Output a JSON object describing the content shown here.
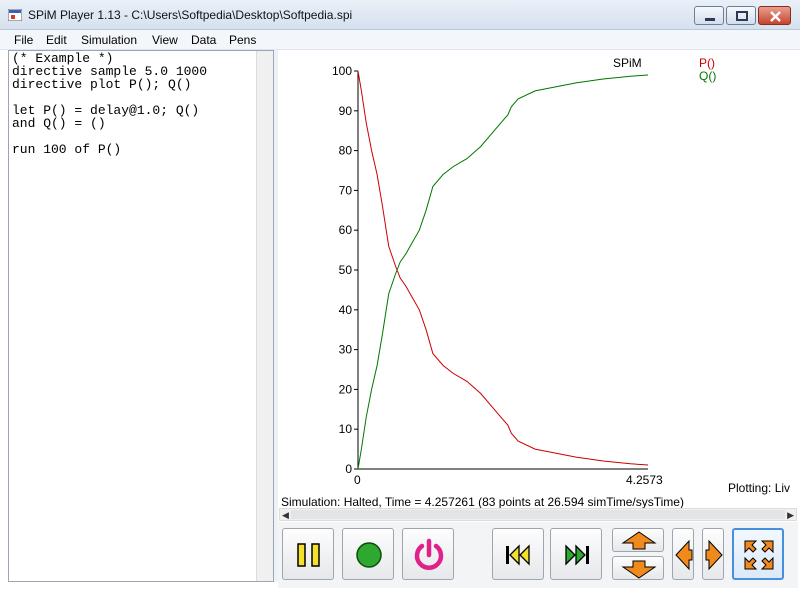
{
  "window": {
    "title": "SPiM Player 1.13 - C:\\Users\\Softpedia\\Desktop\\Softpedia.spi"
  },
  "menu": [
    "File",
    "Edit",
    "Simulation",
    "View",
    "Data",
    "Pens"
  ],
  "editor": {
    "lines": [
      "(* Example *)",
      "directive sample 5.0 1000",
      "directive plot P(); Q()",
      "",
      "let P() = delay@1.0; Q()",
      "and Q() = ()",
      "",
      "run 100 of P()"
    ]
  },
  "status": {
    "simulation": "Simulation: Halted, Time = 4.257261 (83 points at 26.594 simTime/sysTime)",
    "plotting": "Plotting: Liv"
  },
  "colors": {
    "P": "#cc0000",
    "Q": "#007700",
    "accent": "#4a8ee0"
  },
  "toolbar": {
    "buttons": [
      {
        "name": "pause",
        "icon": "pause-icon"
      },
      {
        "name": "record",
        "icon": "record-icon"
      },
      {
        "name": "power",
        "icon": "power-icon"
      },
      {
        "name": "rewind",
        "icon": "fast-rewind-icon"
      },
      {
        "name": "forward",
        "icon": "fast-forward-icon"
      },
      {
        "name": "zoom-up",
        "icon": "arrow-up-icon"
      },
      {
        "name": "zoom-down",
        "icon": "arrow-down-icon"
      },
      {
        "name": "scroll-left",
        "icon": "arrow-left-icon"
      },
      {
        "name": "scroll-right",
        "icon": "arrow-right-icon"
      },
      {
        "name": "fit",
        "icon": "expand-icon"
      }
    ]
  },
  "chart_data": {
    "type": "line",
    "title": "SPiM",
    "xlim": [
      0,
      4.2573
    ],
    "ylim": [
      0,
      100
    ],
    "x_ticks": [
      "0",
      "4.2573"
    ],
    "y_ticks": [
      0,
      10,
      20,
      30,
      40,
      50,
      60,
      70,
      80,
      90,
      100
    ],
    "legend": [
      "P()",
      "Q()"
    ],
    "legend_position": "top-right",
    "grid": false,
    "series": [
      {
        "name": "P()",
        "color": "#cc0000",
        "x": [
          0,
          0.05,
          0.12,
          0.2,
          0.28,
          0.36,
          0.45,
          0.55,
          0.62,
          0.7,
          0.8,
          0.9,
          1.0,
          1.1,
          1.25,
          1.4,
          1.6,
          1.8,
          2.0,
          2.1,
          2.2,
          2.25,
          2.35,
          2.6,
          2.9,
          3.2,
          3.6,
          4.0,
          4.2573
        ],
        "y": [
          100,
          95,
          87,
          80,
          74,
          66,
          56,
          51,
          48,
          46,
          43,
          40,
          35,
          29,
          26,
          24,
          22,
          19,
          15,
          13,
          11,
          9,
          7,
          5,
          4,
          3,
          2,
          1.3,
          1
        ]
      },
      {
        "name": "Q()",
        "color": "#007700",
        "x": [
          0,
          0.05,
          0.12,
          0.2,
          0.28,
          0.36,
          0.45,
          0.55,
          0.62,
          0.7,
          0.8,
          0.9,
          1.0,
          1.1,
          1.25,
          1.4,
          1.6,
          1.8,
          2.0,
          2.1,
          2.2,
          2.25,
          2.35,
          2.6,
          2.9,
          3.2,
          3.6,
          4.0,
          4.2573
        ],
        "y": [
          0,
          5,
          13,
          20,
          26,
          34,
          44,
          49,
          52,
          54,
          57,
          60,
          65,
          71,
          74,
          76,
          78,
          81,
          85,
          87,
          89,
          91,
          93,
          95,
          96,
          97,
          98,
          98.7,
          99
        ]
      }
    ]
  }
}
